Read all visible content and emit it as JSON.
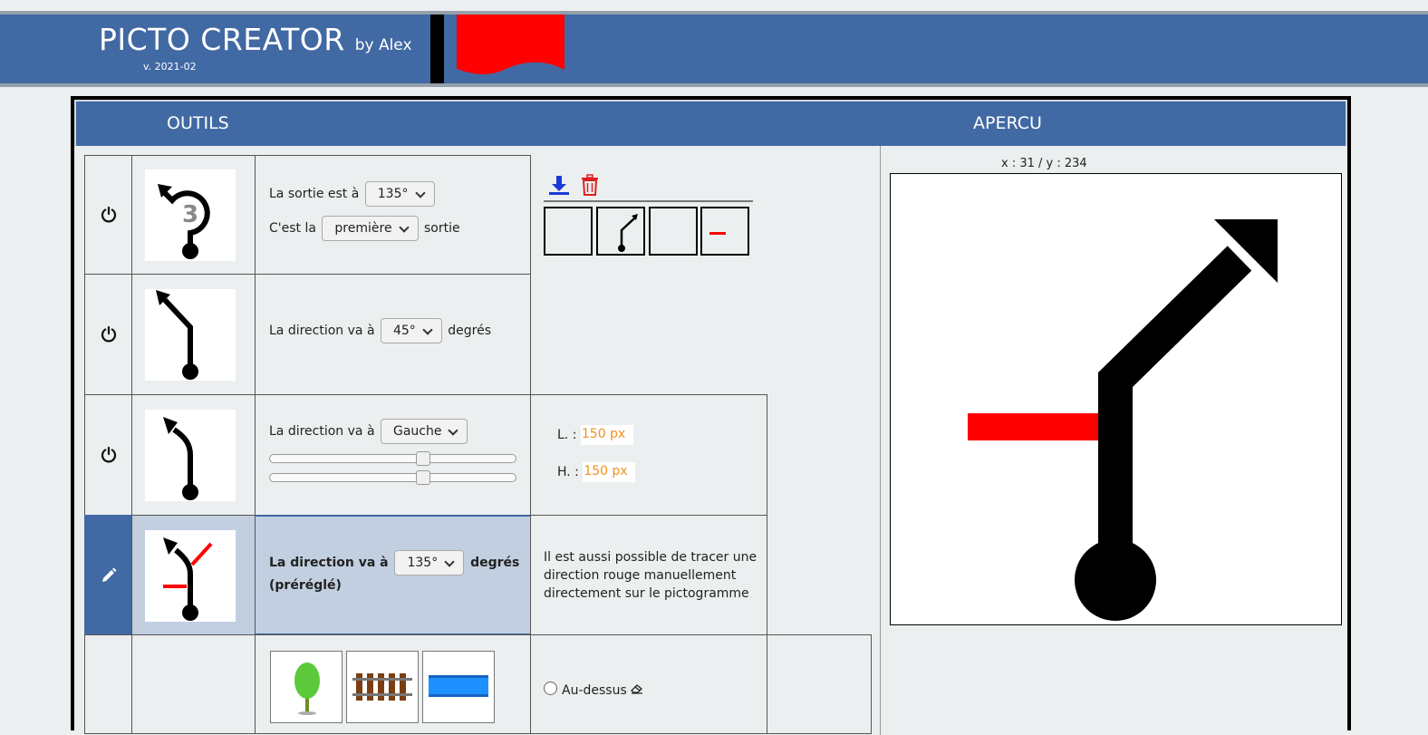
{
  "header": {
    "title": "PICTO CREATOR",
    "by": "by Alex",
    "version": "v. 2021-02",
    "flag_color": "#ff0000",
    "bg_color": "#4169a3"
  },
  "panels": {
    "tools_label": "OUTILS",
    "preview_label": "APERCU"
  },
  "rows": [
    {
      "power_icon": "power-icon",
      "line1_prefix": "La sortie est à",
      "line1_select": "135°",
      "line2_prefix": "C'est la",
      "line2_select": "première",
      "line2_suffix": "sortie",
      "roundabout_number": "3"
    },
    {
      "power_icon": "power-icon",
      "prefix": "La direction va à",
      "select": "45°",
      "suffix": "degrés"
    },
    {
      "power_icon": "power-icon",
      "prefix": "La direction va à",
      "select": "Gauche",
      "slider1": 0.63,
      "slider2": 0.63,
      "width_label": "L. :",
      "width_value": "150 px",
      "height_label": "H. :",
      "height_value": "150 px"
    },
    {
      "edit_icon": "pencil-icon",
      "prefix": "La direction va à",
      "select": "135°",
      "suffix": "degrés",
      "note": "(préréglé)",
      "description": [
        "Il est aussi possible de tracer une",
        "direction rouge manuellement",
        "directement sur le pictogramme"
      ]
    },
    {
      "images": [
        "tree-image",
        "railway-image",
        "river-image"
      ],
      "radio_label": "Au-dessus"
    }
  ],
  "toolbar": {
    "download_icon": "download-icon",
    "delete_icon": "trash-icon",
    "history_count": 4
  },
  "preview": {
    "coord_text": "x : 31 / y : 234"
  },
  "colors": {
    "accent_blue": "#4169a3",
    "selected_row": "#c1cfe0",
    "value_orange": "#f0901e",
    "download_blue": "#1a3ad6",
    "delete_red": "#e02020"
  }
}
